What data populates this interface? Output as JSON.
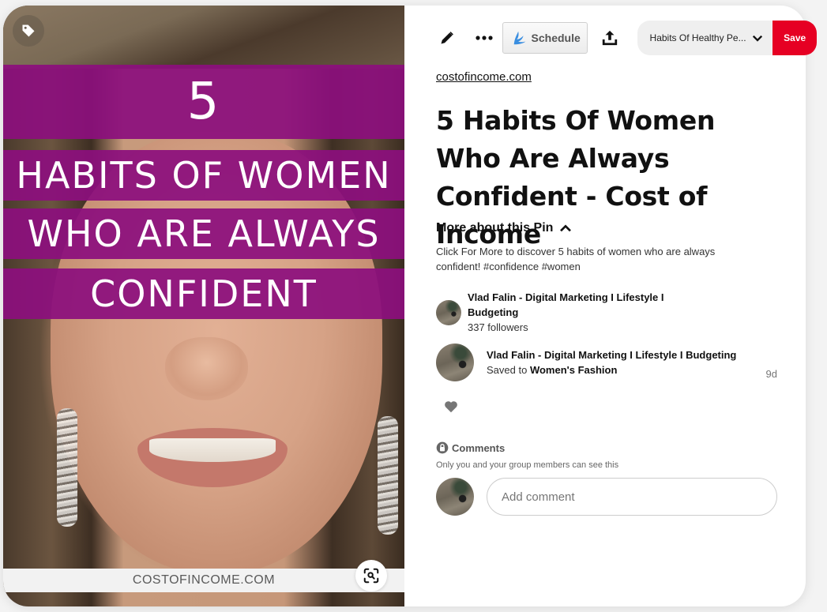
{
  "pin_image": {
    "overlay_lines": [
      "5",
      "HABITS OF WOMEN",
      "WHO ARE ALWAYS",
      "CONFIDENT"
    ],
    "footer_text": "COSTOFINCOME.COM",
    "tag_icon": "tag-icon",
    "lens_icon": "visual-search-icon",
    "band_color": "#8c0f7d"
  },
  "toolbar": {
    "edit_icon": "pencil-icon",
    "more_icon": "ellipsis-icon",
    "schedule_label": "Schedule",
    "share_icon": "share-upload-icon",
    "board_select_value": "Habits Of Healthy Pe...",
    "save_label": "Save",
    "save_color": "#e60023"
  },
  "pin": {
    "source_link": "costofincome.com",
    "title": "5 Habits Of Women Who Are Always Confident - Cost of Income",
    "more_about_label": "More about this Pin",
    "description": "Click For More to discover 5 habits of women who are always confident! #confidence #women"
  },
  "creator": {
    "name": "Vlad Falin - Digital Marketing I Lifestyle I Budgeting",
    "followers": "337 followers"
  },
  "activity": {
    "name": "Vlad Falin - Digital Marketing I Lifestyle I Budgeting",
    "saved_prefix": "Saved to",
    "board": "Women's Fashion",
    "time": "9d"
  },
  "comments": {
    "title": "Comments",
    "privacy_note": "Only you and your group members can see this",
    "input_placeholder": "Add comment",
    "input_value": ""
  }
}
